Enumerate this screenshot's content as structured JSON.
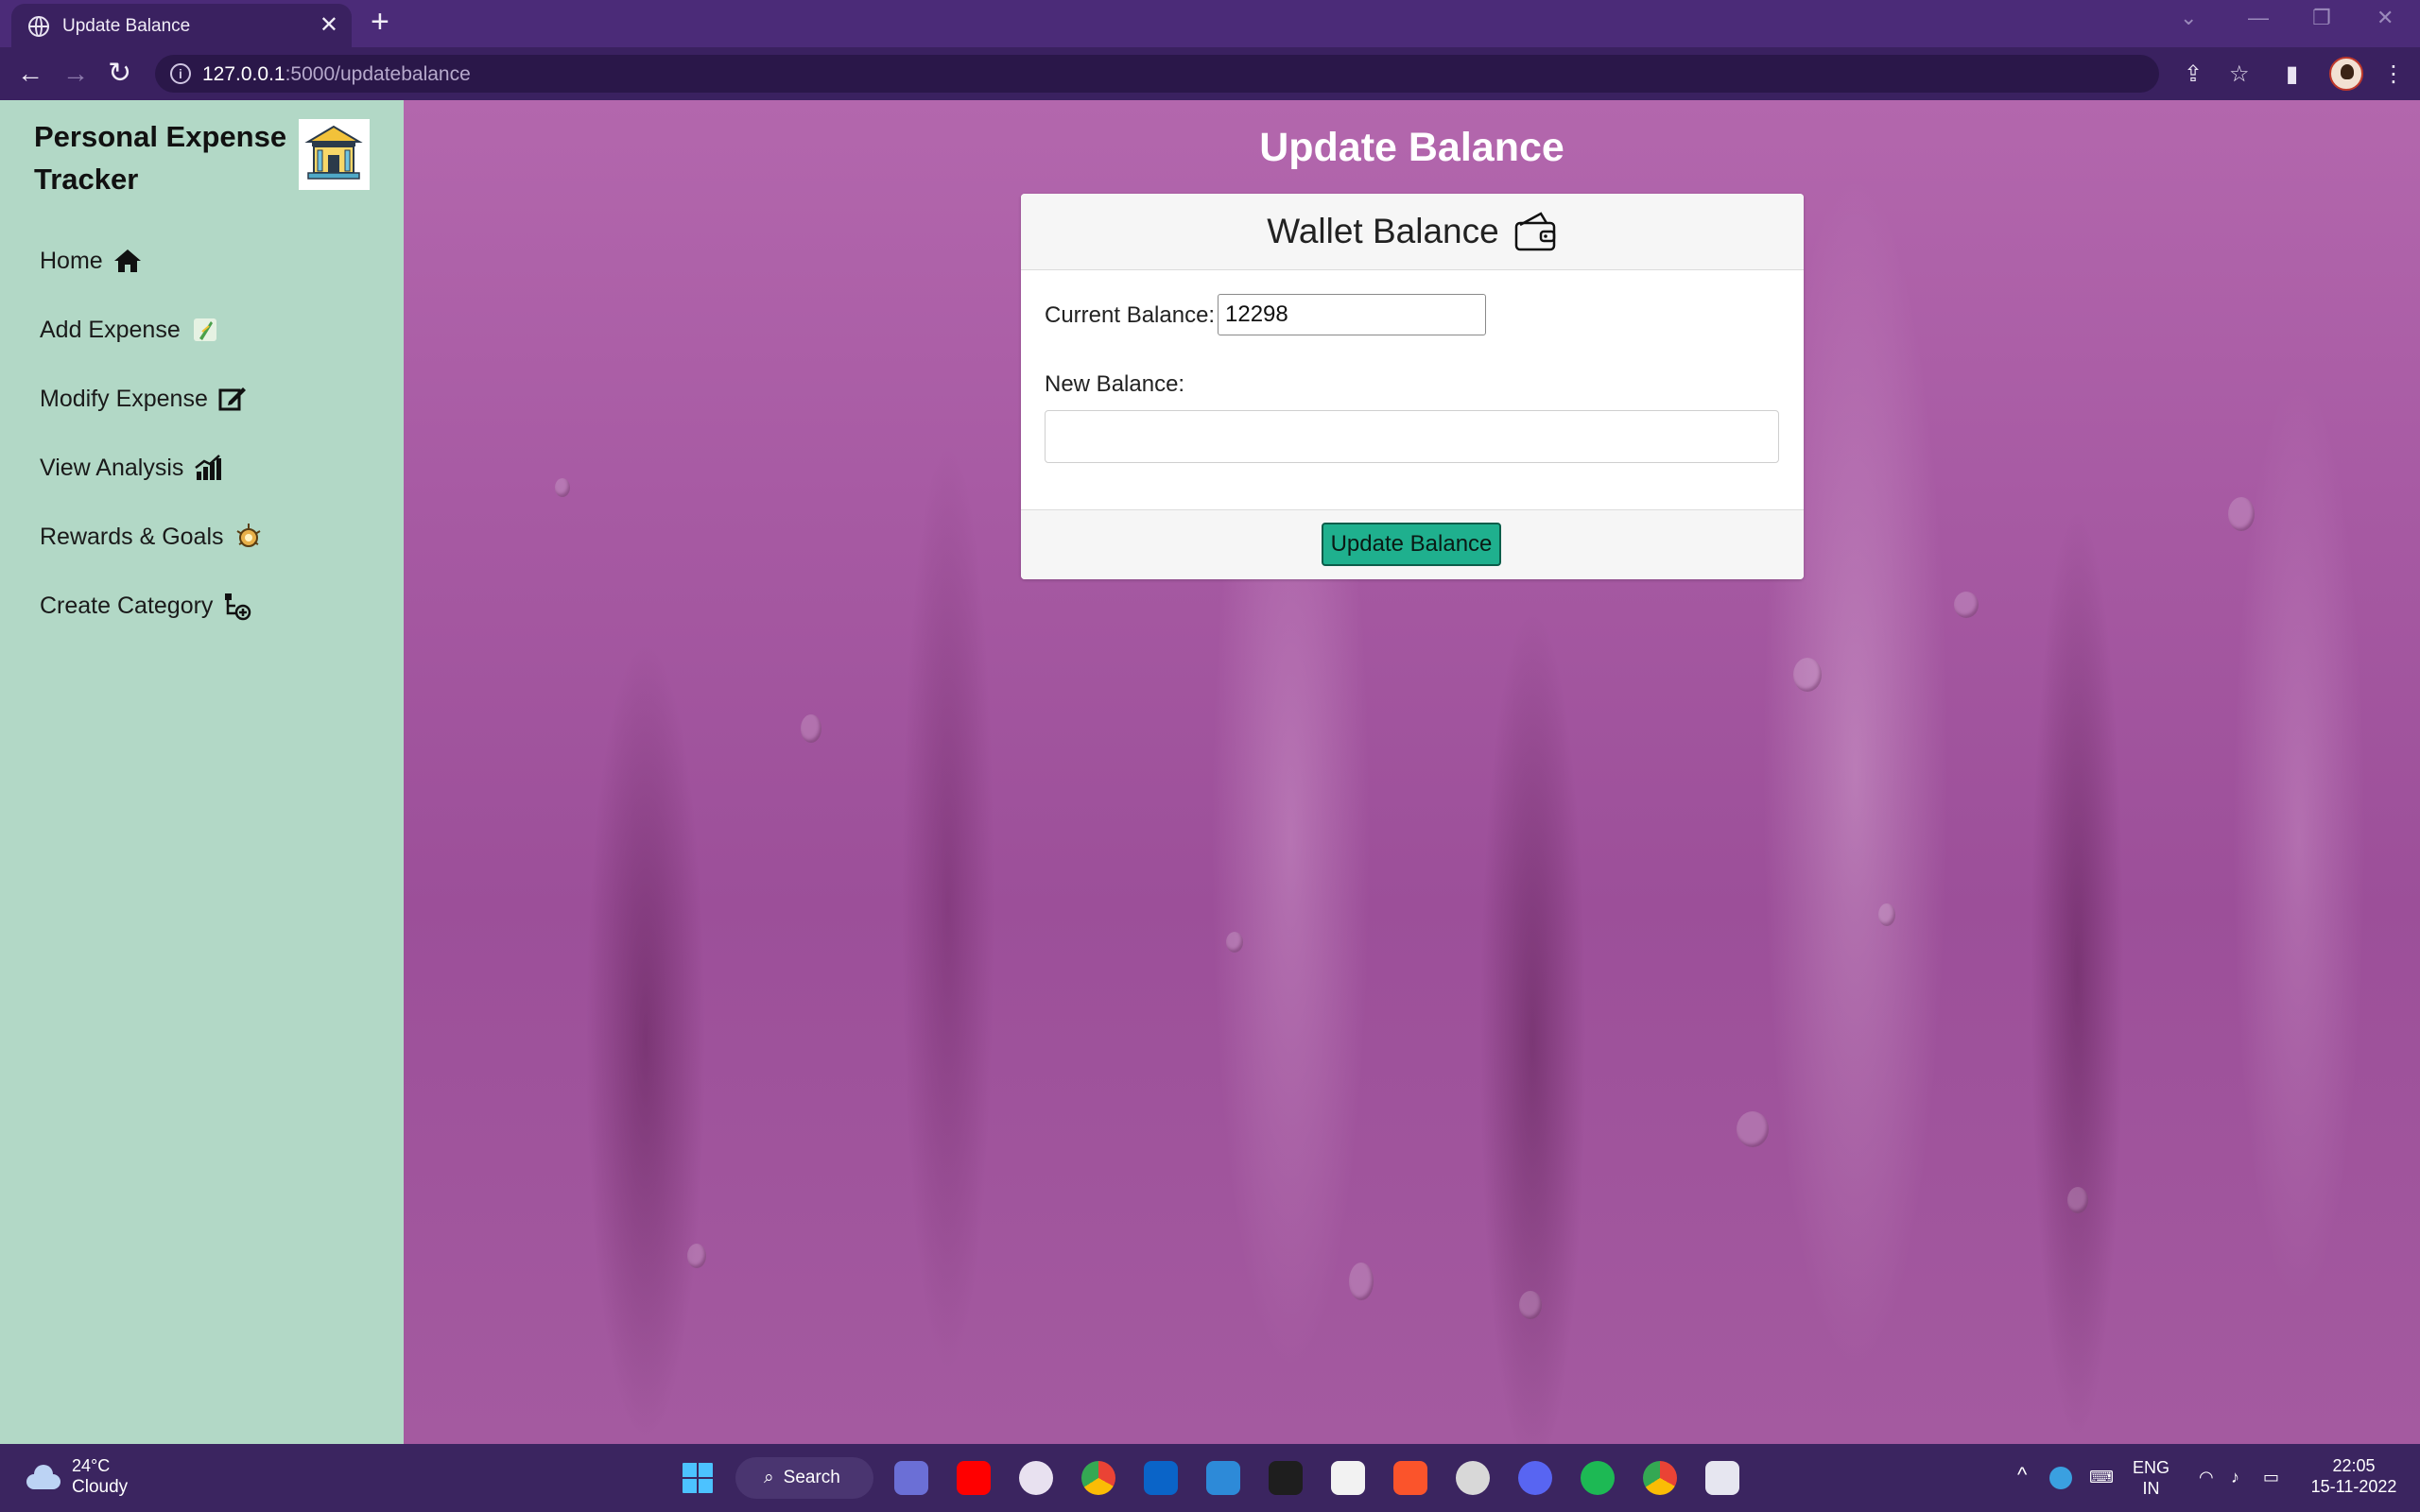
{
  "browser": {
    "tab_title": "Update Balance",
    "tab_close": "✕",
    "new_tab": "+",
    "url_host": "127.0.0.1",
    "url_path": ":5000/updatebalance"
  },
  "sidebar": {
    "brand": "Personal Expense Tracker",
    "items": [
      {
        "label": "Home",
        "icon": "home-icon"
      },
      {
        "label": "Add Expense",
        "icon": "add-expense-icon"
      },
      {
        "label": "Modify Expense",
        "icon": "edit-icon"
      },
      {
        "label": "View Analysis",
        "icon": "chart-icon"
      },
      {
        "label": "Rewards & Goals",
        "icon": "reward-icon"
      },
      {
        "label": "Create Category",
        "icon": "category-icon"
      }
    ]
  },
  "main": {
    "page_title": "Update Balance",
    "card_title": "Wallet Balance",
    "current_balance_label": "Current Balance:",
    "current_balance_value": "12298",
    "new_balance_label": "New Balance:",
    "new_balance_value": "",
    "submit_label": "Update Balance",
    "accent_color": "#1fb08e",
    "sidebar_color": "#b2d8c6"
  },
  "taskbar": {
    "temperature": "24°C",
    "weather": "Cloudy",
    "search_label": "Search",
    "language": "ENG",
    "region": "IN",
    "time": "22:05",
    "date": "15-11-2022"
  }
}
